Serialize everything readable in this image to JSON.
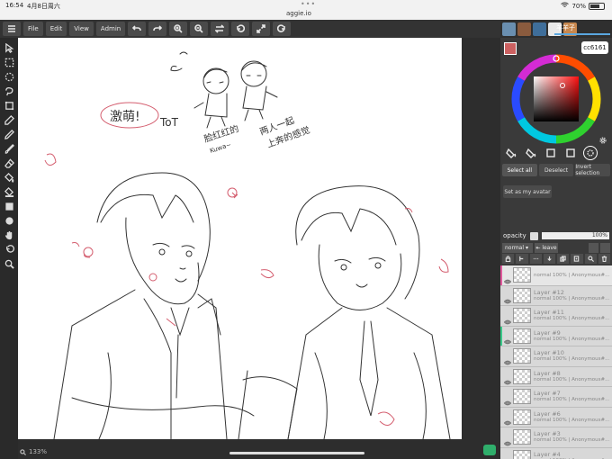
{
  "status": {
    "time": "16:54",
    "date": "4月8日周六",
    "dots": "•••",
    "url": "aggie.io",
    "battery": "70%"
  },
  "toolbar": {
    "file": "File",
    "edit": "Edit",
    "view": "View",
    "admin": "Admin"
  },
  "users": {
    "current": "羊羊子"
  },
  "color": {
    "primary": "#cc6161",
    "secondary": "#e8c24a",
    "hex": "cc6161"
  },
  "selection": {
    "select_all": "Select all",
    "deselect": "Deselect",
    "invert": "Invert selection",
    "avatar": "Set as my avatar"
  },
  "opacity": {
    "label": "opacity",
    "value": "100%"
  },
  "layer_controls": {
    "blend": "normal",
    "leave": "leave"
  },
  "layers": [
    {
      "name": "",
      "meta": "normal 100% | Anonymous#...",
      "marker": "#e05a9c"
    },
    {
      "name": "Layer #12",
      "meta": "normal 100% | Anonymous#...",
      "marker": ""
    },
    {
      "name": "Layer #11",
      "meta": "normal 100% | Anonymous#...",
      "marker": ""
    },
    {
      "name": "Layer #9",
      "meta": "normal 100% | Anonymous#...",
      "marker": "#3cc98a"
    },
    {
      "name": "Layer #10",
      "meta": "normal 100% | Anonymous#...",
      "marker": ""
    },
    {
      "name": "Layer #8",
      "meta": "normal 100% | Anonymous#...",
      "marker": ""
    },
    {
      "name": "Layer #7",
      "meta": "normal 100% | Anonymous#...",
      "marker": ""
    },
    {
      "name": "Layer #6",
      "meta": "normal 100% | Anonymous#...",
      "marker": ""
    },
    {
      "name": "Layer #3",
      "meta": "normal 100% | Anonymous#...",
      "marker": ""
    },
    {
      "name": "Layer #4",
      "meta": "normal 100% | Anonymous#...",
      "marker": ""
    }
  ],
  "canvas": {
    "zoom": "133%",
    "annotation_left": "激萌!",
    "annotation_face": "ToT",
    "annotation_caption1": "脸红红的",
    "annotation_caption2": "两人一起",
    "annotation_caption3": "上奔的感觉",
    "annotation_small": "Kuwa~"
  }
}
